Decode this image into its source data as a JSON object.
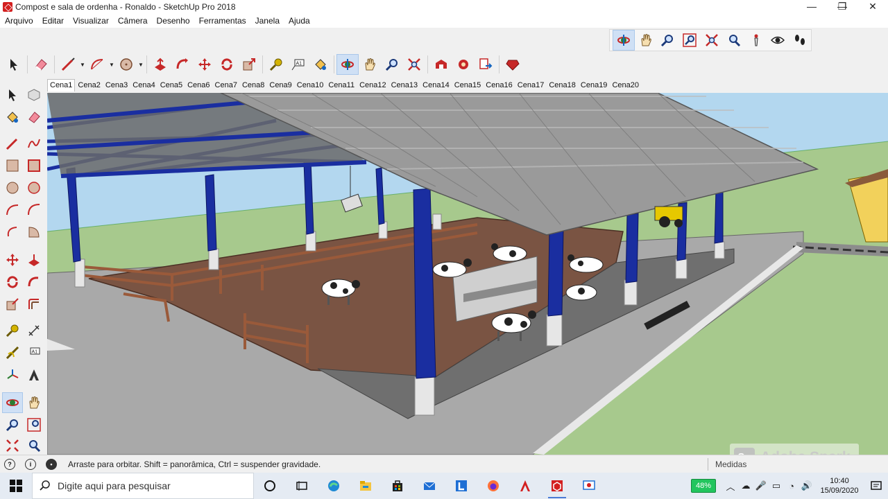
{
  "window": {
    "title": "Compost e sala de ordenha - Ronaldo - SketchUp Pro 2018",
    "controls": {
      "minimize": "—",
      "maximize": "❐",
      "close": "✕"
    }
  },
  "menu": [
    "Arquivo",
    "Editar",
    "Visualizar",
    "Câmera",
    "Desenho",
    "Ferramentas",
    "Janela",
    "Ajuda"
  ],
  "toolbar": {
    "main_icons": [
      "select-icon",
      "eraser-icon",
      "line-icon",
      "arc-icon",
      "circle-icon",
      "push-pull-icon",
      "follow-me-icon",
      "move-icon",
      "rotate-icon",
      "scale-icon",
      "tape-measure-icon",
      "text-icon",
      "paint-bucket-icon",
      "orbit-icon",
      "pan-icon",
      "zoom-icon",
      "zoom-extents-icon",
      "warehouse-icon",
      "extension-icon",
      "send-to-layout-icon",
      "ruby-icon"
    ],
    "nav_icons": [
      "orbit-icon",
      "pan-icon",
      "zoom-icon",
      "zoom-window-icon",
      "zoom-extents-icon",
      "previous-view-icon",
      "position-camera-icon",
      "look-around-icon",
      "walk-icon"
    ]
  },
  "scenes": {
    "tabs": [
      "Cena1",
      "Cena2",
      "Cena3",
      "Cena4",
      "Cena5",
      "Cena6",
      "Cena7",
      "Cena8",
      "Cena9",
      "Cena10",
      "Cena11",
      "Cena12",
      "Cena13",
      "Cena14",
      "Cena15",
      "Cena16",
      "Cena17",
      "Cena18",
      "Cena19",
      "Cena20"
    ],
    "active": "Cena1"
  },
  "viewport": {
    "model": "Compost barn with milking shed, cows and metal roof",
    "colors": {
      "sky": "#b3d7ef",
      "grass": "#a7c98d",
      "floor": "#7a5443",
      "columns": "#1a2ea0",
      "roof": "#9a9a9a",
      "pavement": "#a9a9a9"
    }
  },
  "watermark": {
    "logo": "Sp",
    "text": "Adobe Spark"
  },
  "status": {
    "message": "Arraste para orbitar. Shift = panorâmica, Ctrl = suspender gravidade.",
    "measure_label": "Medidas"
  },
  "taskbar": {
    "search_placeholder": "Digite aqui para pesquisar",
    "apps": [
      "cortana-icon",
      "task-view-icon",
      "edge-icon",
      "file-explorer-icon",
      "store-icon",
      "mail-icon",
      "layout-icon",
      "firefox-icon",
      "acrobat-icon",
      "sketchup-icon",
      "style-builder-icon"
    ],
    "battery": "48%",
    "time": "10:40",
    "date": "15/09/2020"
  }
}
